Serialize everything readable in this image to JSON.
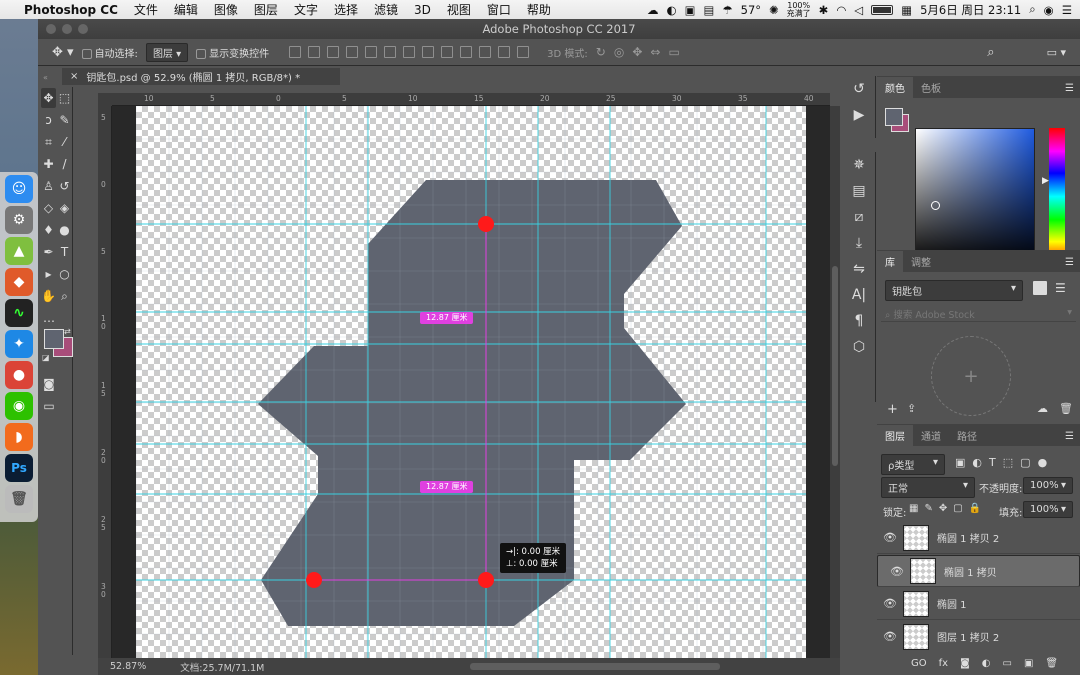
{
  "menubar": {
    "app": "Photoshop CC",
    "items": [
      "文件",
      "编辑",
      "图像",
      "图层",
      "文字",
      "选择",
      "滤镜",
      "3D",
      "视图",
      "窗口",
      "帮助"
    ],
    "temp": "57°",
    "battery_line1": "100%",
    "battery_line2": "充满了",
    "datetime": "5月6日 周日  23:11"
  },
  "window": {
    "title": "Adobe Photoshop CC 2017"
  },
  "options": {
    "auto_select_label": "自动选择:",
    "auto_select_value": "图层",
    "show_transform_label": "显示变换控件",
    "mode_3d_label": "3D 模式:"
  },
  "document": {
    "tab_label": "钥匙包.psd @ 52.9% (椭圆 1 拷贝, RGB/8*) *",
    "zoom": "52.87%",
    "doc_size": "文档:25.7M/71.1M",
    "measure1": "12.87 厘米",
    "measure2": "12.87 厘米",
    "readout_dx": "→|: 0.00 厘米",
    "readout_dy": "⊥: 0.00 厘米"
  },
  "ruler_top": [
    "10",
    "5",
    "0",
    "5",
    "10",
    "15",
    "20",
    "25",
    "30",
    "35",
    "40"
  ],
  "ruler_left": [
    "5",
    "0",
    "5",
    "1\n0",
    "1\n5",
    "2\n0",
    "2\n5",
    "3\n0"
  ],
  "colors": {
    "shape": "#5f6470",
    "guide": "#3ad0e0",
    "marker": "#ff1a1a",
    "fg_swatch": "#5f6470",
    "bg_swatch": "#a84d7a"
  },
  "color_panel": {
    "tabs": [
      "颜色",
      "色板"
    ]
  },
  "library_panel": {
    "tabs": [
      "库",
      "调整"
    ],
    "library_name": "钥匙包",
    "search_placeholder": "搜索 Adobe Stock"
  },
  "layers_panel": {
    "tabs": [
      "图层",
      "通道",
      "路径"
    ],
    "kind_filter": "ρ类型",
    "blend_mode": "正常",
    "opacity_label": "不透明度:",
    "opacity_value": "100%",
    "lock_label": "锁定:",
    "fill_label": "填充:",
    "fill_value": "100%",
    "layers": [
      {
        "name": "椭圆 1 拷贝 2",
        "selected": false
      },
      {
        "name": "椭圆 1 拷贝",
        "selected": true
      },
      {
        "name": "椭圆 1",
        "selected": false
      },
      {
        "name": "图层 1 拷贝 2",
        "selected": false
      }
    ]
  }
}
